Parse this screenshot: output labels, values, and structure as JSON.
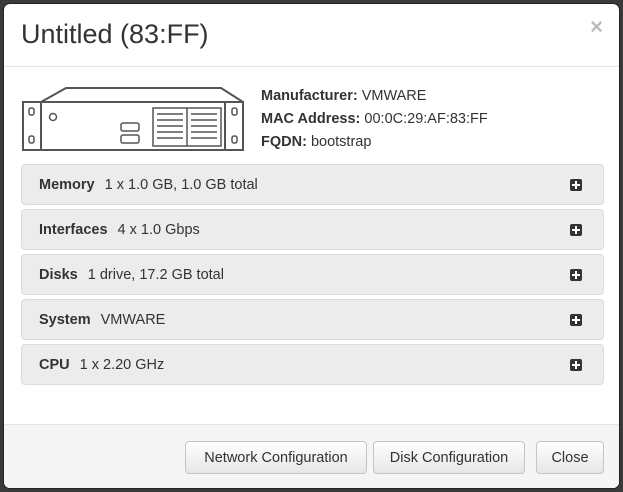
{
  "modal": {
    "title": "Untitled (83:FF)",
    "close_glyph": "×"
  },
  "device": {
    "icon": "server-rack-icon",
    "manufacturer_label": "Manufacturer:",
    "manufacturer_value": "VMWARE",
    "mac_label": "MAC Address:",
    "mac_value": "00:0C:29:AF:83:FF",
    "fqdn_label": "FQDN:",
    "fqdn_value": "bootstrap"
  },
  "panels": [
    {
      "name": "Memory",
      "value": "1 x 1.0 GB, 1.0 GB total"
    },
    {
      "name": "Interfaces",
      "value": "4 x 1.0 Gbps"
    },
    {
      "name": "Disks",
      "value": "1 drive, 17.2 GB total"
    },
    {
      "name": "System",
      "value": "VMWARE"
    },
    {
      "name": "CPU",
      "value": "1 x 2.20 GHz"
    }
  ],
  "footer": {
    "network_label": "Network Configuration",
    "disk_label": "Disk Configuration",
    "close_label": "Close"
  },
  "colors": {
    "panel_bg": "#ececec",
    "backdrop": "#3a3a3a",
    "text": "#333333"
  }
}
